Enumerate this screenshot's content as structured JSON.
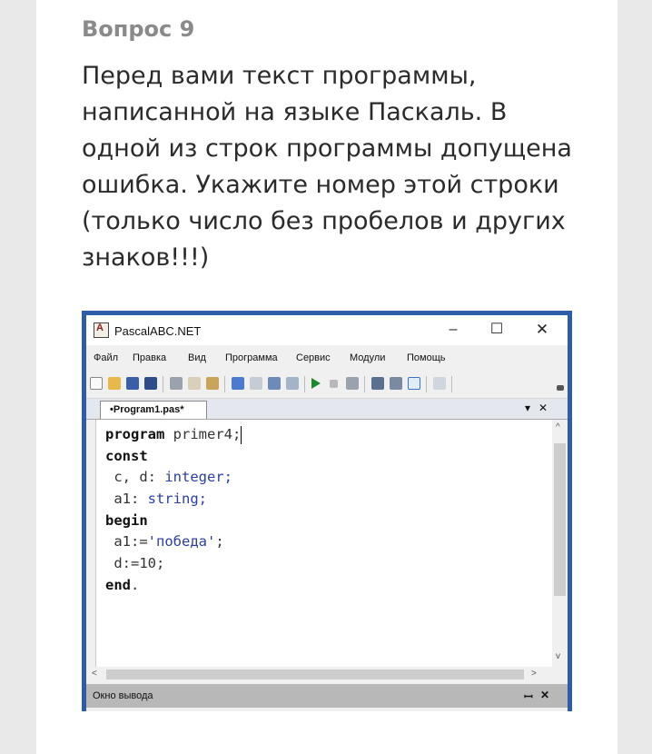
{
  "question": {
    "number_label": "Вопрос 9",
    "text": "Перед вами текст программы, написанной на языке Паскаль. В одной из строк программы допущена ошибка. Укажите номер этой строки (только число без пробелов и других знаков!!!)"
  },
  "ide": {
    "title": "PascalABC.NET",
    "window_controls": {
      "minimize": "–",
      "maximize": "☐",
      "close": "✕"
    },
    "menu": [
      "Файл",
      "Правка",
      "Вид",
      "Программа",
      "Сервис",
      "Модули",
      "Помощь"
    ],
    "tab": {
      "label": "•Program1.pas*",
      "dropdown": "▾",
      "close": "✕"
    },
    "code": {
      "line1": {
        "kw": "program",
        "rest": " primer4;"
      },
      "line2": {
        "kw": "const"
      },
      "line3": {
        "a": " c, d: ",
        "t": "integer;"
      },
      "line4": {
        "a": " a1: ",
        "t": "string;"
      },
      "line5": {
        "kw": "begin"
      },
      "line6": {
        "a": " a1:=",
        "s": "'победа'",
        "b": ";"
      },
      "line7": {
        "a": " d:=",
        "n": "10",
        "b": ";"
      },
      "line8": {
        "kw": "end",
        "b": "."
      }
    },
    "output_panel": {
      "title": "Окно вывода",
      "pin": "ꟷ",
      "close": "✕"
    },
    "scroll_arrows": {
      "up": "^",
      "down": "v",
      "left": "<",
      "right": ">"
    }
  }
}
